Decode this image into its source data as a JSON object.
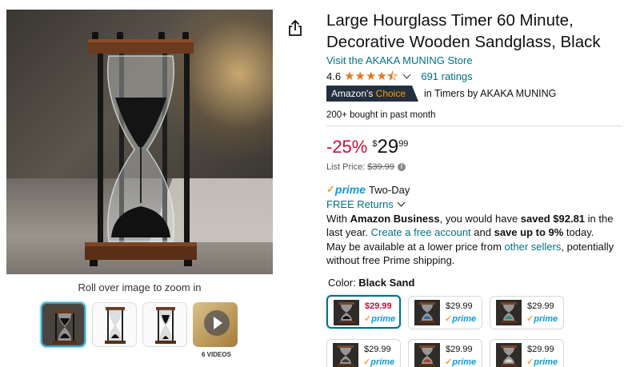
{
  "gallery": {
    "zoom_hint": "Roll over image to zoom in",
    "videos_label": "6 VIDEOS",
    "main_image_icon": "hourglass-image",
    "thumbnail_icons": [
      "hourglass-thumbnail",
      "hourglass-thumbnail",
      "hourglass-thumbnail",
      "video-thumbnail"
    ]
  },
  "share": {
    "icon": "share-icon"
  },
  "product": {
    "title": "Large Hourglass Timer 60 Minute, Decorative Wooden Sandglass, Black",
    "store_link": "Visit the AKAKA MUNING Store",
    "rating": "4.6",
    "rating_stars": 4.5,
    "ratings_count": "691 ratings",
    "badge_prefix": "Amazon's",
    "badge_choice": "Choice",
    "badge_context": "in Timers by AKAKA MUNING",
    "bought": "200+ bought in past month"
  },
  "price": {
    "discount": "-25%",
    "currency": "$",
    "whole": "29",
    "fraction": "99",
    "list_label": "List Price:",
    "list_value": "$39.99"
  },
  "delivery": {
    "prime_check": "✓",
    "prime_word": "prime",
    "two_day": "Two-Day",
    "free_returns": "FREE Returns"
  },
  "business": {
    "t1": "With ",
    "b1": "Amazon Business",
    "t2": ", you would have ",
    "b2": "saved $92.81",
    "t3": " in the last year. ",
    "link": "Create a free account",
    "t4": " and ",
    "b3": "save up to 9%",
    "t5": " today."
  },
  "availability": {
    "t1": "May be available at a lower price from ",
    "link": "other sellers",
    "t2": ", potentially without free Prime shipping."
  },
  "color": {
    "label": "Color: ",
    "selected": "Black Sand",
    "swatches": [
      {
        "price": "$29.99",
        "prime": "prime",
        "sand": "#1c1c1c"
      },
      {
        "price": "$29.99",
        "prime": "prime",
        "sand": "#2a6fa8"
      },
      {
        "price": "$29.99",
        "prime": "prime",
        "sand": "#2f8f7c"
      },
      {
        "price": "$29.99",
        "prime": "prime",
        "sand": "#3a3a3a"
      },
      {
        "price": "$29.99",
        "prime": "prime",
        "sand": "#b83232"
      },
      {
        "price": "$29.99",
        "prime": "prime",
        "sand": "#d9d4cc"
      }
    ]
  }
}
